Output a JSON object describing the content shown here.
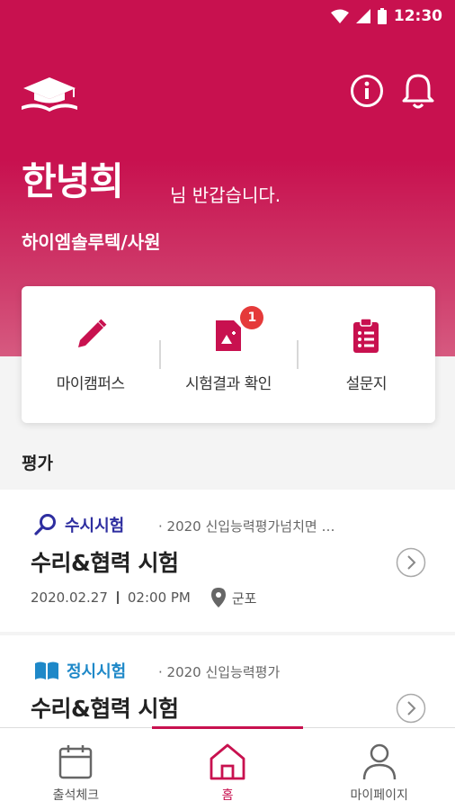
{
  "status": {
    "time": "12:30"
  },
  "header": {
    "username": "한녕희",
    "greeting": "님 반갑습니다.",
    "company": "하이엠솔루텍/사원"
  },
  "quick_menu": {
    "items": [
      {
        "label": "마이캠퍼스",
        "icon": "pencil-icon"
      },
      {
        "label": "시험결과 확인",
        "icon": "document-icon",
        "badge": "1"
      },
      {
        "label": "설문지",
        "icon": "clipboard-icon"
      }
    ]
  },
  "section": {
    "title": "평가"
  },
  "exams": [
    {
      "type": "수시시험",
      "type_color": "#2e2ea0",
      "icon": "search-icon",
      "subtitle": "· 2020 신입능력평가넘치면 …",
      "title": "수리&협력 시험",
      "date": "2020.02.27",
      "time": "02:00 PM",
      "location": "군포"
    },
    {
      "type": "정시시험",
      "type_color": "#1e88c8",
      "icon": "book-icon",
      "subtitle": "· 2020 신입능력평가",
      "title": "수리&협력 시험"
    }
  ],
  "tabbar": {
    "items": [
      {
        "label": "출석체크",
        "icon": "calendar-icon"
      },
      {
        "label": "홈",
        "icon": "home-icon",
        "active": true
      },
      {
        "label": "마이페이지",
        "icon": "person-icon"
      }
    ]
  },
  "colors": {
    "brand": "#c8114f",
    "badge": "#e53a3a"
  }
}
